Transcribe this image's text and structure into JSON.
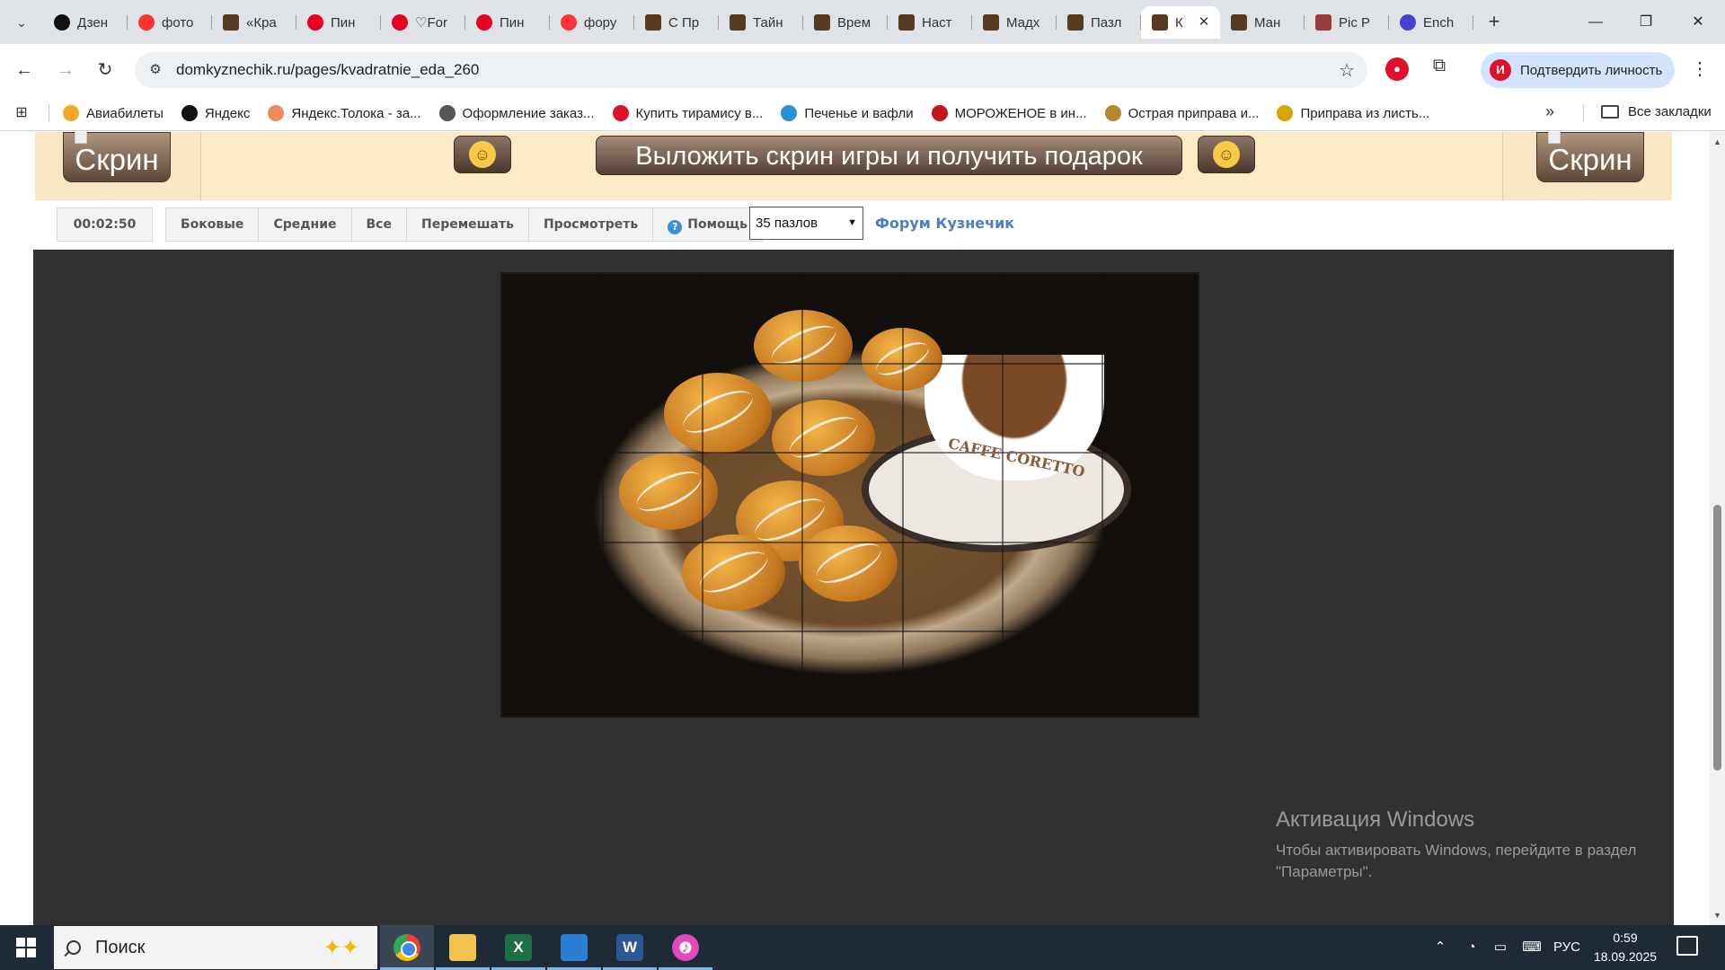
{
  "browser": {
    "tabs": [
      {
        "title": "Дзен",
        "favicon": "dzen"
      },
      {
        "title": "фото",
        "favicon": "yandex"
      },
      {
        "title": "«Кра",
        "favicon": "kuz"
      },
      {
        "title": "Пин",
        "favicon": "pin"
      },
      {
        "title": "♡For",
        "favicon": "pin"
      },
      {
        "title": "Пин",
        "favicon": "pin"
      },
      {
        "title": "фору",
        "favicon": "yandex"
      },
      {
        "title": "С Пр",
        "favicon": "kuz"
      },
      {
        "title": "Тайн",
        "favicon": "kuz"
      },
      {
        "title": "Врем",
        "favicon": "kuz"
      },
      {
        "title": "Наст",
        "favicon": "kuz"
      },
      {
        "title": "Мадх",
        "favicon": "kuz"
      },
      {
        "title": "Пазл",
        "favicon": "kuz"
      },
      {
        "title": "К",
        "favicon": "kuz",
        "active": true
      },
      {
        "title": "Ман",
        "favicon": "kuz"
      },
      {
        "title": "Pic P",
        "favicon": "pic"
      },
      {
        "title": "Ench",
        "favicon": "ench"
      }
    ],
    "new_tab_icon": "plus-icon",
    "url": "domkyznechik.ru/pages/kvadratnie_eda_260",
    "profile_label": "Подтвердить личность",
    "profile_initial": "И",
    "bookmarks": [
      {
        "label": "Авиабилеты",
        "color": "#f5a623"
      },
      {
        "label": "Яндекс",
        "color": "#111111"
      },
      {
        "label": "Яндекс.Толока - за...",
        "color": "#f08a5d"
      },
      {
        "label": "Оформление заказ...",
        "color": "#555555"
      },
      {
        "label": "Купить тирамису в...",
        "color": "#e0102a"
      },
      {
        "label": "Печенье и вафли",
        "color": "#2a8fd8"
      },
      {
        "label": "МОРОЖЕНОЕ в ин...",
        "color": "#c4161c"
      },
      {
        "label": "Острая приправа и...",
        "color": "#b5892b"
      },
      {
        "label": "Приправа из листь...",
        "color": "#d9a400"
      }
    ],
    "bookmarks_more": "»",
    "all_bookmarks": "Все закладки"
  },
  "page": {
    "banner": {
      "skrin_left": "Скрин",
      "skrin_right": "Скрин",
      "headline": "Выложить скрин игры и получить подарок"
    },
    "controls": {
      "timer": "00:02:50",
      "mode_buttons": [
        "Боковые",
        "Средние",
        "Все"
      ],
      "action_buttons": [
        "Перемешать",
        "Просмотреть"
      ],
      "help": "Помощь",
      "pieces_select": "35 пазлов",
      "forum_link": "Форум Кузнечик"
    },
    "puzzle": {
      "rows": 5,
      "cols": 7,
      "cup_text": "CAFFE CORETTO"
    },
    "watermark": {
      "title": "Активация Windows",
      "line1": "Чтобы активировать Windows, перейдите в раздел",
      "line2": "\"Параметры\"."
    }
  },
  "taskbar": {
    "search_placeholder": "Поиск",
    "apps": [
      "chrome",
      "file-explorer",
      "excel",
      "photos",
      "word",
      "itunes"
    ],
    "lang": "РУС",
    "time": "0:59",
    "date": "18.09.2025"
  }
}
